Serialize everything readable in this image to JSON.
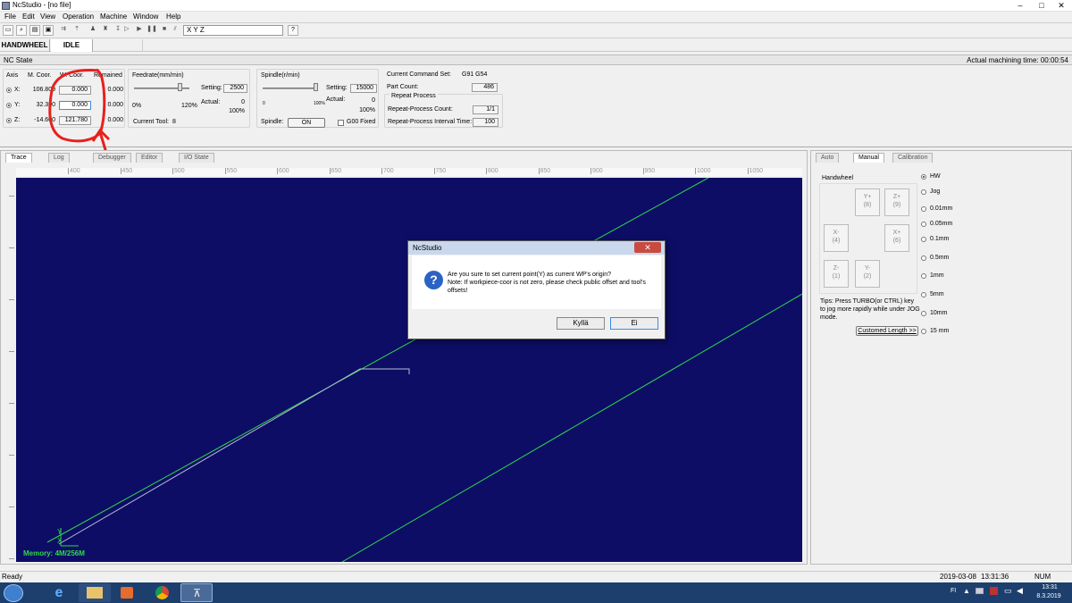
{
  "window": {
    "title": "NcStudio - [no file]",
    "controls": [
      "–",
      "□",
      "✕"
    ]
  },
  "menu": [
    "File",
    "Edit",
    "View",
    "Operation",
    "Machine",
    "Window",
    "Help"
  ],
  "toolbar": {
    "coord_text": "X        Y        Z",
    "help_glyph": "?"
  },
  "mode": {
    "mode": "HANDWHEEL",
    "state": "IDLE"
  },
  "nc_state": {
    "label": "NC State",
    "machining_time": "Actual machining time: 00:00:54"
  },
  "axis_panel": {
    "headers": {
      "axis": "Axis",
      "mcoor": "M. Coor.",
      "wcoor": "W. Coor.",
      "remained": "Remained"
    },
    "rows": [
      {
        "axis": "X:",
        "mcoor": "106.809",
        "wcoor": "0.000",
        "remained": "0.000"
      },
      {
        "axis": "Y:",
        "mcoor": "32.300",
        "wcoor": "0.000",
        "remained": "0.000"
      },
      {
        "axis": "Z:",
        "mcoor": "-14.600",
        "wcoor": "121.780",
        "remained": "0.000"
      }
    ]
  },
  "feedrate": {
    "title": "Feedrate(mm/min)",
    "setting_label": "Setting:",
    "setting": "2500",
    "actual_label": "Actual:",
    "actual": "0",
    "pct": "100%",
    "min": "0%",
    "max": "120%",
    "tool_label": "Current Tool:",
    "tool": "8",
    "slider_fraction": 0.83
  },
  "spindle": {
    "title": "Spindle(r/min)",
    "setting_label": "Setting:",
    "setting": "15000",
    "actual_label": "Actual:",
    "actual": "0",
    "pct": "100%",
    "min": "0",
    "max": "100%",
    "spindle_label": "Spindle:",
    "spindle_btn": "ON",
    "g00_label": "G00 Fixed",
    "slider_fraction": 1.0
  },
  "command": {
    "label": "Current Command Set:",
    "value": "G91 G54",
    "part_label": "Part Count:",
    "part": "486",
    "repeat_title": "Repeat Process",
    "repeat_count_label": "Repeat-Process Count:",
    "repeat_count": "1/1",
    "repeat_interval_label": "Repeat-Process Interval Time:",
    "repeat_interval": "100"
  },
  "left_tabs": [
    "Trace",
    "Log",
    "Debugger",
    "Editor",
    "I/O State"
  ],
  "ruler_ticks": [
    "400",
    "450",
    "500",
    "550",
    "600",
    "650",
    "700",
    "750",
    "800",
    "850",
    "900",
    "950",
    "1000",
    "1050"
  ],
  "canvas": {
    "memory": "Memory: 4M/256M",
    "axis_x": "X",
    "axis_y": "Y"
  },
  "right_tabs": [
    "Auto",
    "Manual",
    "Calibration"
  ],
  "handwheel": {
    "title": "Handwheel",
    "buttons": [
      {
        "id": "yplus",
        "label": "Y+",
        "key": "(8)"
      },
      {
        "id": "zplus",
        "label": "Z+",
        "key": "(9)"
      },
      {
        "id": "xminus",
        "label": "X-",
        "key": "(4)"
      },
      {
        "id": "xplus",
        "label": "X+",
        "key": "(6)"
      },
      {
        "id": "zminus",
        "label": "Z-",
        "key": "(1)"
      },
      {
        "id": "yminus",
        "label": "Y-",
        "key": "(2)"
      }
    ],
    "options": [
      "HW",
      "Jog",
      "0.01mm",
      "0.05mm",
      "0.1mm",
      "0.5mm",
      "1mm",
      "5mm",
      "10mm",
      "15  mm"
    ],
    "selected": "HW",
    "tips": "Tips: Press TURBO(or CTRL) key to jog more rapidly while under JOG mode.",
    "custom_btn": "Customed Length  >>"
  },
  "dialog": {
    "title": "NcStudio",
    "line1": "Are you sure to set current point(Y) as current WP's origin?",
    "line2": "Note: If workpiece-coor is not zero, please check public offset and tool's offsets!",
    "yes": "Kyllä",
    "no": "Ei"
  },
  "statusbar": {
    "ready": "Ready",
    "date": "2019-03-08",
    "time": "13:31:36",
    "num": "NUM"
  },
  "taskbar": {
    "lang": "FI",
    "clock_time": "13:31",
    "clock_date": "8.3.2019"
  },
  "colors": {
    "canvas": "#0d0d66",
    "path_green": "#2fd84a",
    "annotation_red": "#e8201c"
  }
}
